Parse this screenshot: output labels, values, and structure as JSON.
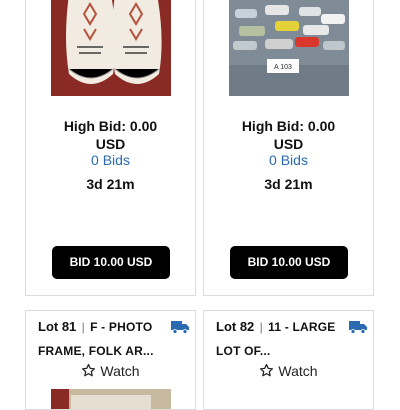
{
  "lots_top": [
    {
      "image_alt": "white beaded moccasins",
      "high_bid_label": "High Bid: 0.00",
      "currency": "USD",
      "bids": "0 Bids",
      "time_left": "3d 21m",
      "bid_button": "BID 10.00 USD"
    },
    {
      "image_alt": "toy cars lot",
      "image_tag": "A 103",
      "high_bid_label": "High Bid: 0.00",
      "currency": "USD",
      "bids": "0 Bids",
      "time_left": "3d 21m",
      "bid_button": "BID 10.00 USD"
    }
  ],
  "lots_bottom": [
    {
      "lot_number": "Lot 81",
      "separator": "|",
      "title_line1": "F - PHOTO",
      "title_line2": "FRAME, FOLK AR...",
      "watch_label": "Watch",
      "icons": [
        "truck-icon",
        "star-outline-icon"
      ]
    },
    {
      "lot_number": "Lot 82",
      "separator": "|",
      "title_line1": "11 - LARGE",
      "title_line2": "LOT OF...",
      "watch_label": "Watch",
      "icons": [
        "truck-icon",
        "star-outline-icon"
      ]
    }
  ],
  "colors": {
    "bids_link": "#2a6ab1",
    "button_bg": "#000000",
    "button_text": "#ffffff",
    "truck_icon": "#2a6ab1",
    "card_border": "#dcdcdc"
  }
}
